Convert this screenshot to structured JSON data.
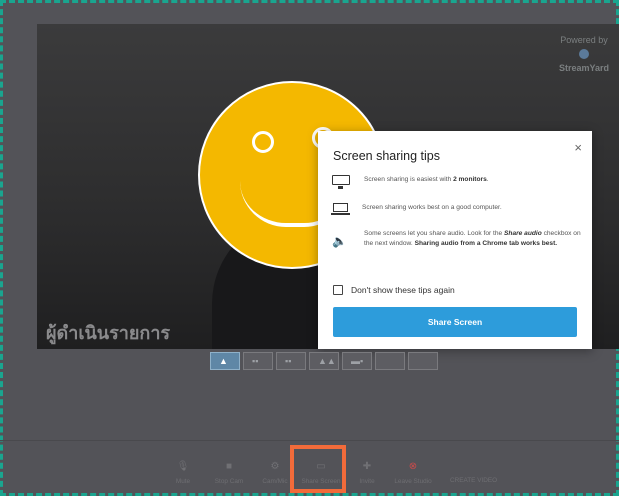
{
  "stage": {
    "caption": "ผู้ดำเนินรายการ",
    "watermark": {
      "top": "Powered by",
      "name": "StreamYard"
    }
  },
  "modal": {
    "title": "Screen sharing tips",
    "close_label": "×",
    "tips": [
      {
        "icon": "monitor-icon",
        "text_before": "Screen sharing is easiest with ",
        "bold": "2 monitors",
        "text_after": "."
      },
      {
        "icon": "laptop-icon",
        "text": "Screen sharing works best on a good computer."
      },
      {
        "icon": "speaker-icon",
        "line1": "Some screens let you share audio. Look for the ",
        "bold1": "Share audio",
        "line2": " checkbox on the next window. ",
        "bold2": "Sharing audio from a Chrome tab works best."
      }
    ],
    "checkbox_label": "Don't show these tips again",
    "checkbox_checked": false,
    "share_button": "Share Screen"
  },
  "layouts": [
    {
      "icon": "person-icon",
      "active": true
    },
    {
      "icon": "two-people-icon",
      "active": false
    },
    {
      "icon": "grid-icon",
      "active": false
    },
    {
      "icon": "group-icon",
      "active": false
    },
    {
      "icon": "spotlight-icon",
      "active": false
    },
    {
      "icon": "split-icon",
      "active": false
    },
    {
      "icon": "blank-icon",
      "active": false
    }
  ],
  "toolbar": {
    "mute": "Mute",
    "stop_cam": "Stop Cam",
    "cam_mic": "Cam/Mic",
    "share_screen": "Share Screen",
    "invite": "Invite",
    "leave": "Leave Studio",
    "end": "CREATE VIDEO"
  },
  "colors": {
    "accent": "#2d9cdb",
    "highlight": "#f26b3a",
    "smiley": "#f4b800",
    "frame_dash": "#1aa58f"
  }
}
